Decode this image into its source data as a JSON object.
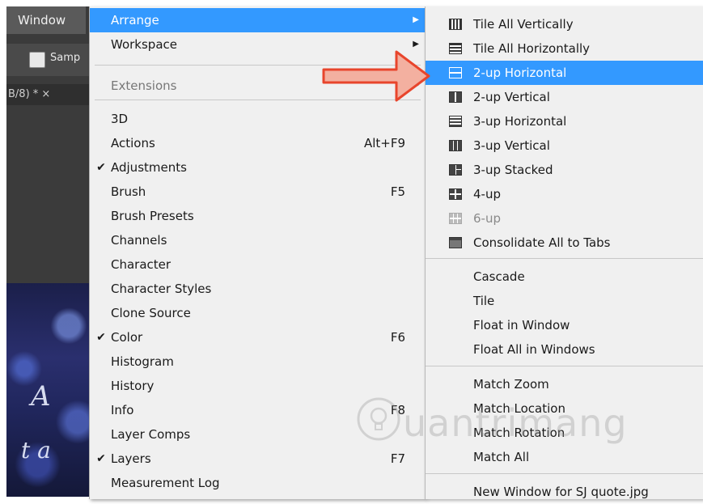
{
  "background": {
    "menubar_window": "Window",
    "options_sample_label": "Samp",
    "doc_tab": "B/8) *  ×"
  },
  "window_menu": {
    "items": [
      {
        "label": "Arrange",
        "has_submenu": true,
        "highlighted": true
      },
      {
        "label": "Workspace",
        "has_submenu": true
      },
      {
        "label": "Extensions",
        "disabled": true,
        "has_submenu": true
      },
      {
        "label": "3D"
      },
      {
        "label": "Actions",
        "shortcut": "Alt+F9"
      },
      {
        "label": "Adjustments",
        "checked": true
      },
      {
        "label": "Brush",
        "shortcut": "F5"
      },
      {
        "label": "Brush Presets"
      },
      {
        "label": "Channels"
      },
      {
        "label": "Character"
      },
      {
        "label": "Character Styles"
      },
      {
        "label": "Clone Source"
      },
      {
        "label": "Color",
        "checked": true,
        "shortcut": "F6"
      },
      {
        "label": "Histogram"
      },
      {
        "label": "History"
      },
      {
        "label": "Info",
        "shortcut": "F8"
      },
      {
        "label": "Layer Comps"
      },
      {
        "label": "Layers",
        "checked": true,
        "shortcut": "F7"
      },
      {
        "label": "Measurement Log"
      }
    ],
    "checkmark": "✔",
    "submenu_arrow": "▶"
  },
  "arrange_menu": {
    "items": [
      {
        "label": "Tile All Vertically",
        "icon": "tile-vertical-icon"
      },
      {
        "label": "Tile All Horizontally",
        "icon": "tile-horizontal-icon"
      },
      {
        "label": "2-up Horizontal",
        "icon": "two-up-horizontal-icon",
        "highlighted": true
      },
      {
        "label": "2-up Vertical",
        "icon": "two-up-vertical-icon"
      },
      {
        "label": "3-up Horizontal",
        "icon": "three-up-horizontal-icon"
      },
      {
        "label": "3-up Vertical",
        "icon": "three-up-vertical-icon"
      },
      {
        "label": "3-up Stacked",
        "icon": "three-up-stacked-icon"
      },
      {
        "label": "4-up",
        "icon": "four-up-icon"
      },
      {
        "label": "6-up",
        "icon": "six-up-icon",
        "disabled": true
      },
      {
        "label": "Consolidate All to Tabs",
        "icon": "consolidate-tabs-icon"
      },
      {
        "label": "Cascade"
      },
      {
        "label": "Tile"
      },
      {
        "label": "Float in Window"
      },
      {
        "label": "Float All in Windows"
      },
      {
        "label": "Match Zoom"
      },
      {
        "label": "Match Location"
      },
      {
        "label": "Match Rotation"
      },
      {
        "label": "Match All"
      },
      {
        "label": "New Window for SJ quote.jpg"
      }
    ]
  },
  "colors": {
    "highlight": "#3399ff",
    "menu_bg": "#f0f0f0",
    "annotation_arrow": "#e8452c"
  },
  "watermark": {
    "text": "uantrimang"
  }
}
